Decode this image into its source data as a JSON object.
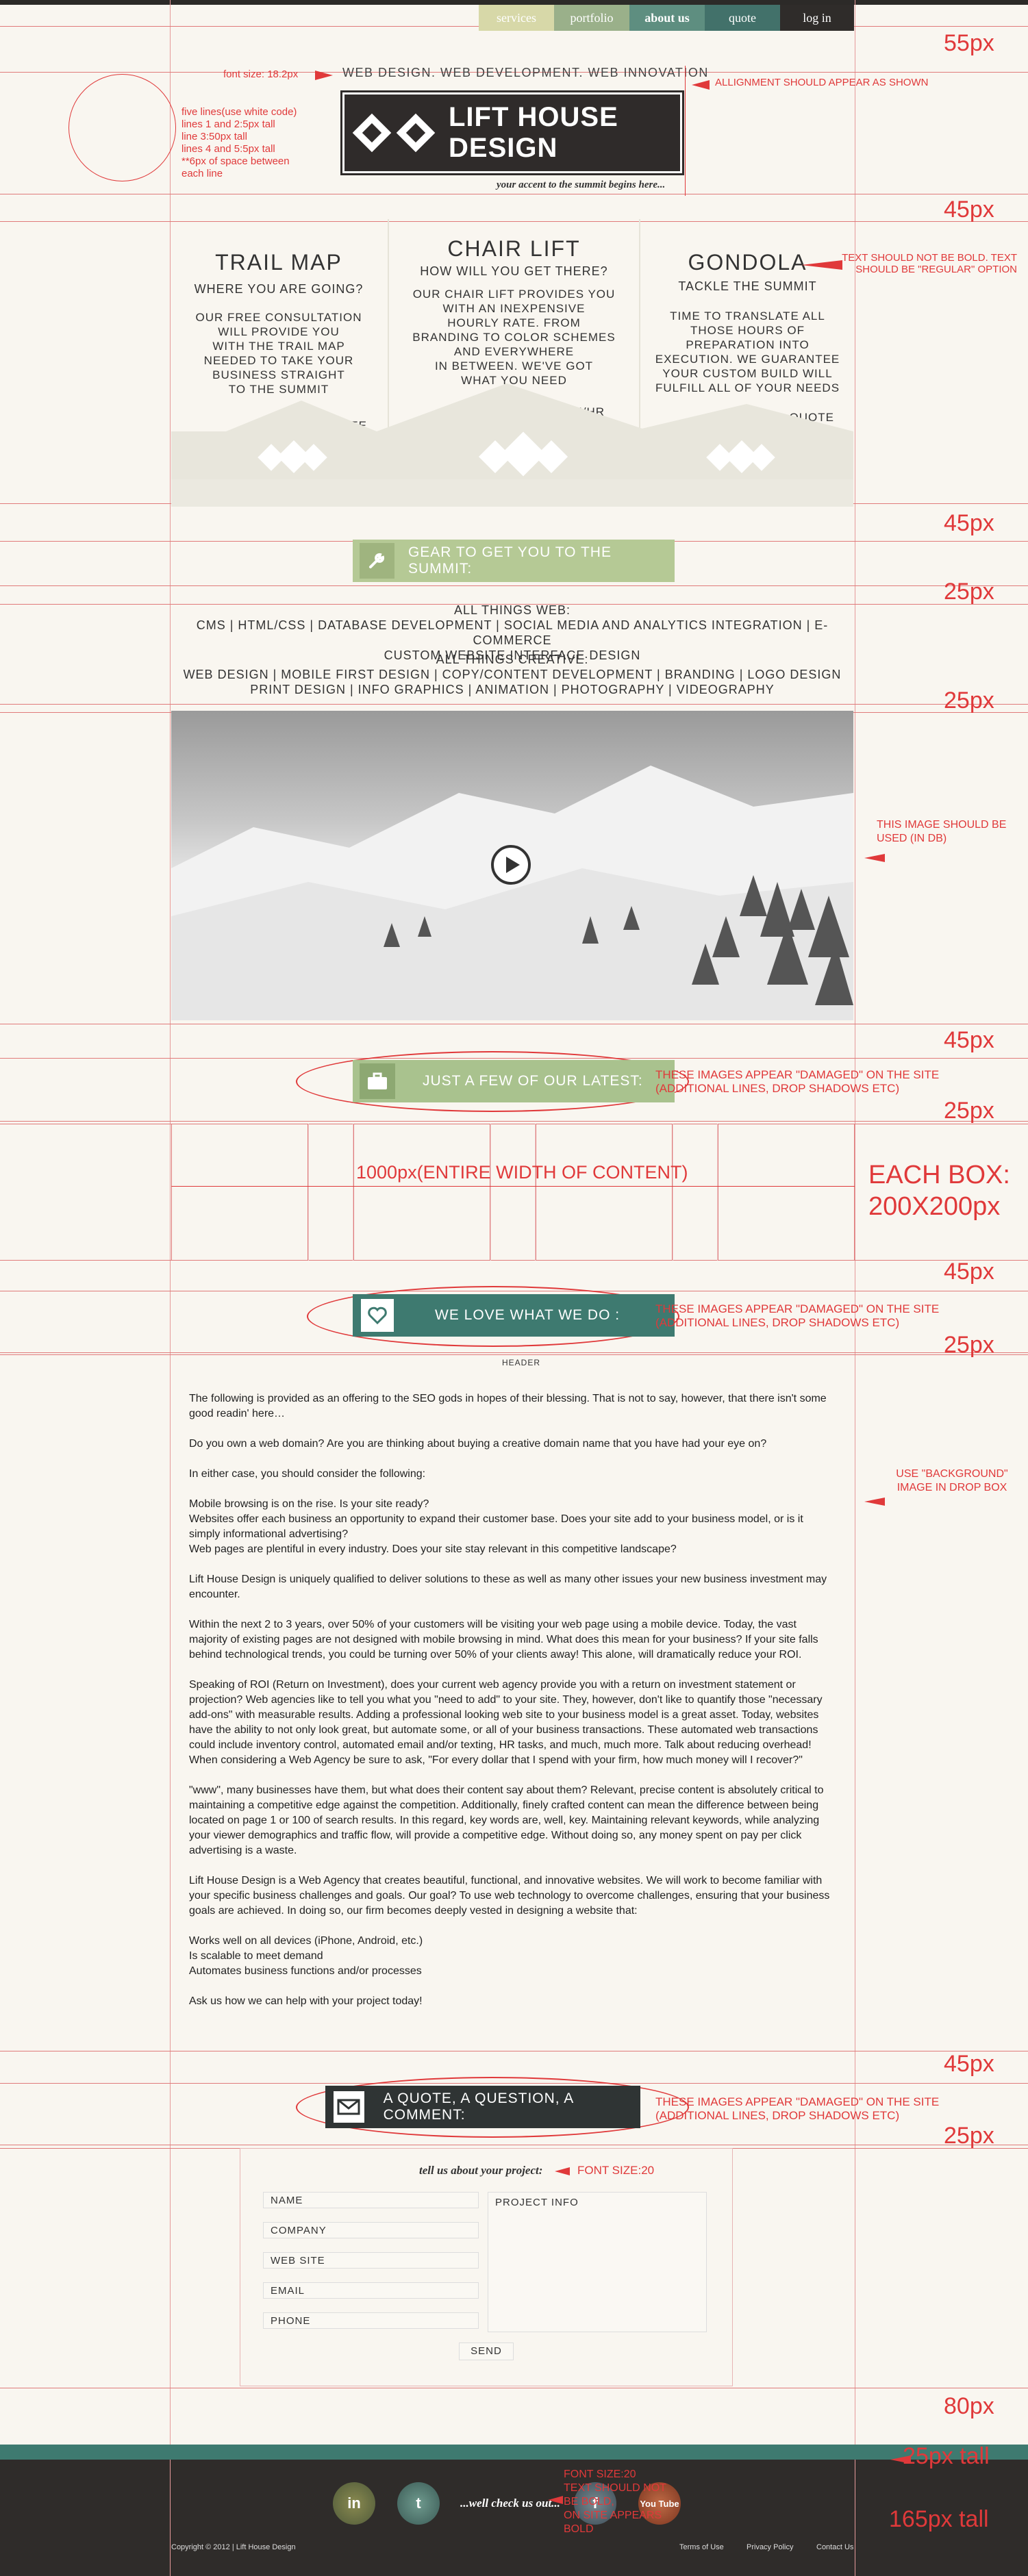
{
  "nav": {
    "services": "services",
    "portfolio": "portfolio",
    "about": "about us",
    "quote": "quote",
    "login": "log in"
  },
  "header": {
    "font_note": "font size: 18.2px",
    "tagline": "WEB DESIGN. WEB DEVELOPMENT. WEB INNOVATION",
    "logo_text": "LIFT HOUSE DESIGN",
    "accent": "your accent to the summit begins here...",
    "lines_note": [
      "five lines(use white code)",
      "lines 1 and 2:5px tall",
      "line 3:50px tall",
      "lines 4 and 5:5px tall",
      "**6px of space between",
      "each line"
    ],
    "align_note": "ALLIGNMENT SHOULD APPEAR AS SHOWN"
  },
  "services": [
    {
      "title": "TRAIL MAP",
      "subtitle": "WHERE YOU ARE GOING?",
      "body": [
        "OUR FREE CONSULTATION",
        "WILL PROVIDE YOU",
        "WITH THE TRAIL MAP",
        "NEEDED TO TAKE YOUR",
        "BUSINESS STRAIGHT",
        "TO THE SUMMIT"
      ],
      "price": "FREE"
    },
    {
      "title": "CHAIR LIFT",
      "subtitle": "HOW WILL YOU GET THERE?",
      "body": [
        "OUR CHAIR LIFT PROVIDES YOU",
        "WITH AN INEXPENSIVE",
        "HOURLY RATE. FROM",
        "BRANDING TO COLOR SCHEMES",
        "AND EVERYWHERE",
        "IN BETWEEN. WE'VE GOT",
        "WHAT YOU NEED"
      ],
      "price": "$75/HR"
    },
    {
      "title": "GONDOLA",
      "subtitle": "TACKLE THE SUMMIT",
      "body": [
        "TIME TO TRANSLATE ALL",
        "THOSE HOURS OF",
        "PREPARATION INTO",
        "EXECUTION. WE GUARANTEE",
        "YOUR CUSTOM BUILD WILL",
        "FULFILL ALL OF YOUR NEEDS"
      ],
      "price": "GET A QUOTE"
    }
  ],
  "bold_note": [
    "TEXT SHOULD NOT BE BOLD. TEXT",
    "SHOULD BE \"REGULAR\" OPTION"
  ],
  "gear_banner": "GEAR TO GET YOU TO THE SUMMIT:",
  "things_web": {
    "title": "ALL THINGS WEB:",
    "line1": "CMS | HTML/CSS | DATABASE DEVELOPMENT | SOCIAL MEDIA AND ANALYTICS INTEGRATION | E-COMMERCE",
    "line2": "CUSTOM WEBSITE INTERFACE DESIGN"
  },
  "things_creative": {
    "title": "ALL THINGS CREATIVE:",
    "line1": "WEB DESIGN | MOBILE FIRST DESIGN | COPY/CONTENT DEVELOPMENT | BRANDING | LOGO DESIGN",
    "line2": "PRINT DESIGN | INFO GRAPHICS | ANIMATION | PHOTOGRAPHY | VIDEOGRAPHY"
  },
  "image_note": [
    "THIS IMAGE SHOULD BE",
    "USED (IN DB)"
  ],
  "portfolio_banner": "JUST A FEW OF OUR LATEST:",
  "damaged_note": [
    "THESE IMAGES APPEAR \"DAMAGED\" ON THE SITE",
    "(ADDITIONAL LINES, DROP SHADOWS ETC)"
  ],
  "boxes_note": "1000px(ENTIRE WIDTH OF CONTENT)",
  "each_box": [
    "EACH BOX:",
    "200X200px"
  ],
  "love_banner": "WE LOVE WHAT WE DO :",
  "header_label": "HEADER",
  "dropbox_note": [
    "USE \"BACKGROUND\"",
    "IMAGE IN DROP BOX"
  ],
  "article": [
    "The following is provided as an offering to the SEO gods in hopes of their blessing. That is not to say, however, that there isn't some good readin' here…",
    "Do you own a web domain? Are you are thinking about buying a creative domain name that you have had your eye on?",
    "In either case, you should consider the following:",
    "Mobile browsing is on the rise. Is your site ready?\nWebsites offer each business an opportunity to expand their customer base. Does your site add to your business model, or is it simply informational advertising?\nWeb pages are plentiful in every industry. Does your site stay relevant in this competitive landscape?",
    "Lift House Design is uniquely qualified to deliver solutions to these as well as many other issues your new business investment may encounter.",
    "Within the next 2 to 3 years, over 50% of your customers will be visiting your web page using a mobile device. Today, the vast majority of existing pages are not designed with mobile browsing in mind. What does this mean for your business? If your site falls behind technological trends, you could be turning over 50% of your clients away! This alone, will dramatically reduce your ROI.",
    "Speaking of ROI (Return on Investment), does your current web agency provide you with a return on investment statement or projection? Web agencies like to tell you what you \"need to add\" to your site. They, however, don't like to quantify those \"necessary add-ons\" with measurable results. Adding a professional looking web site to your business model is a great asset. Today, websites have the ability to not only look great, but automate some, or all of your business transactions. These automated web transactions could include inventory control, automated email and/or texting, HR tasks, and much, much more. Talk about reducing overhead! When considering a Web Agency be sure to ask, \"For every dollar that I spend with your firm, how much money will I recover?\"",
    "\"www\", many businesses have them, but what does their content say about them? Relevant, precise content is absolutely critical to maintaining a competitive edge against the competition. Additionally, finely crafted content can mean the difference between being located on page 1 or 100 of search results. In this regard, key words are, well, key. Maintaining relevant keywords, while analyzing your viewer demographics and traffic flow, will provide a competitive edge. Without doing so, any money spent on pay per click advertising is a waste.",
    "Lift House Design is a Web Agency that creates beautiful, functional, and innovative websites. We will work to become familiar with your specific business challenges and goals. Our goal? To use web technology to overcome challenges, ensuring that your business goals are achieved. In doing so, our firm becomes deeply vested in designing a website that:",
    "Works well on all devices (iPhone, Android, etc.)\nIs scalable to meet demand\nAutomates business functions and/or processes",
    "Ask us how we can help with your project today!"
  ],
  "contact_banner": "A QUOTE, A QUESTION, A COMMENT:",
  "form": {
    "heading": "tell us about your project:",
    "font_note": "FONT SIZE:20",
    "name": "NAME",
    "company": "COMPANY",
    "website": "WEB SITE",
    "email": "EMAIL",
    "phone": "PHONE",
    "project": "PROJECT INFO",
    "send": "SEND"
  },
  "spacing": {
    "s55": "55px",
    "s45a": "45px",
    "s45b": "45px",
    "s25a": "25px",
    "s25b": "25px",
    "s45c": "45px",
    "s25c": "25px",
    "s45d": "45px",
    "s25d": "25px",
    "s45e": "45px",
    "s25e": "25px",
    "s80": "80px",
    "s25tall": "25px tall",
    "s165tall": "165px tall"
  },
  "footer": {
    "check": "...well check us out...",
    "note": [
      "FONT SIZE:20",
      "TEXT SHOULD NOT",
      "BE BOLD,",
      "ON SITE APPEARS",
      "BOLD"
    ],
    "copyright": "Copyright © 2012 | Lift House Design",
    "terms": "Terms of Use",
    "privacy": "Privacy Policy",
    "contact": "Contact Us",
    "social": [
      "in",
      "t",
      "f",
      "You Tube"
    ]
  },
  "colors": {
    "nav_services": "#d7d8a8",
    "nav_portfolio": "#9ab08a",
    "nav_about": "#5e8e80",
    "nav_quote": "#42716a",
    "nav_login": "#2f2c2a",
    "gear_green": "#b5c995",
    "teal": "#3e7a70",
    "dark": "#2f2c2a",
    "annotation_red": "#e0393a"
  }
}
